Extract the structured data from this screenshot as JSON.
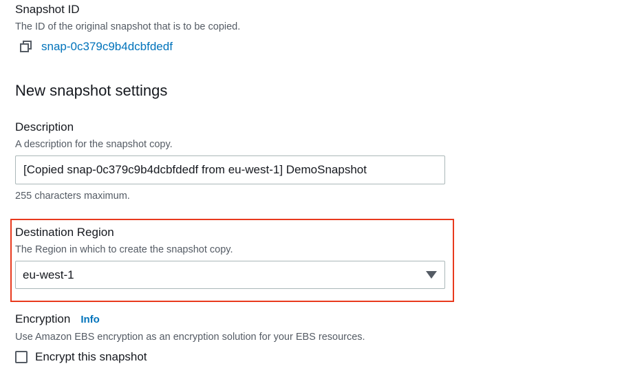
{
  "snapshot_id": {
    "label": "Snapshot ID",
    "description": "The ID of the original snapshot that is to be copied.",
    "value": "snap-0c379c9b4dcbfdedf",
    "copy_icon": "copy-icon"
  },
  "new_settings": {
    "title": "New snapshot settings"
  },
  "description_field": {
    "label": "Description",
    "description": "A description for the snapshot copy.",
    "value": "[Copied snap-0c379c9b4dcbfdedf from eu-west-1] DemoSnapshot",
    "constraint": "255 characters maximum."
  },
  "destination_region": {
    "label": "Destination Region",
    "description": "The Region in which to create the snapshot copy.",
    "selected": "eu-west-1",
    "highlight_color": "#e8391d"
  },
  "encryption": {
    "label": "Encryption",
    "info_link": "Info",
    "description": "Use Amazon EBS encryption as an encryption solution for your EBS resources.",
    "checkbox_label": "Encrypt this snapshot",
    "checked": false
  },
  "colors": {
    "link": "#0073bb",
    "text": "#16191f",
    "secondary_text": "#545b64",
    "border": "#aab7b8"
  }
}
